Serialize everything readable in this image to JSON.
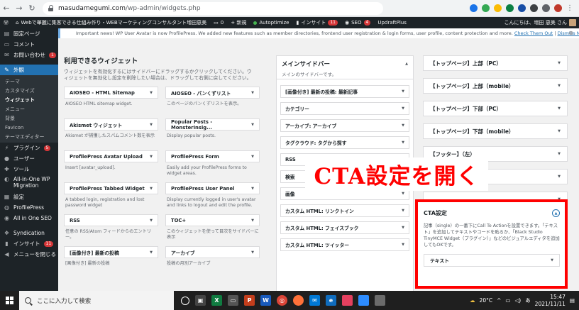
{
  "browser": {
    "url_host": "masudamegumi.com",
    "url_path": "/wp-admin/widgets.php"
  },
  "adminbar": {
    "site": "Webで華麗に集客できる仕組み作り・WEBマーケティングコンサルタント増田恵美",
    "comments": "0",
    "new_label": "+ 新規",
    "autoptimize": "Autoptimize",
    "insight": "インサイト",
    "insight_count": "11",
    "seo": "SEO",
    "seo_count": "4",
    "updraft": "UpdraftPlus",
    "greeting": "こんにちは、増田 恵美 さん"
  },
  "sidebar": {
    "items_top": [
      {
        "label": "固定ページ",
        "icon": "page-icon"
      },
      {
        "label": "コメント",
        "icon": "comment-icon"
      },
      {
        "label": "お問い合わせ",
        "icon": "mail-icon",
        "badge": "1"
      },
      {
        "label": "外観",
        "icon": "brush-icon"
      }
    ],
    "sub": [
      "テーマ",
      "カスタマイズ",
      "ウィジェット",
      "メニュー",
      "背景",
      "Favicon",
      "テーマエディター"
    ],
    "items_bottom": [
      {
        "label": "プラグイン",
        "icon": "plugin-icon",
        "badge": "5"
      },
      {
        "label": "ユーザー",
        "icon": "user-icon"
      },
      {
        "label": "ツール",
        "icon": "tool-icon"
      },
      {
        "label": "All-in-One WP Migration",
        "icon": "migration-icon"
      },
      {
        "label": "設定",
        "icon": "settings-icon"
      },
      {
        "label": "ProfilePress",
        "icon": "profilepress-icon"
      },
      {
        "label": "All in One SEO",
        "icon": "seo-icon"
      },
      {
        "label": "Syndication",
        "icon": "syndication-icon"
      },
      {
        "label": "インサイト",
        "icon": "insight-icon",
        "badge": "11"
      },
      {
        "label": "メニューを閉じる",
        "icon": "collapse-icon"
      }
    ]
  },
  "notice": {
    "text": "Important news! WP User Avatar is now ProfilePress. We added new features such as member directories, frontend user registration & login forms, user profile, content protection and more.",
    "link1": "Check Them Out",
    "sep": "|",
    "link2": "Dismiss Notice"
  },
  "available": {
    "title": "利用できるウィジェット",
    "desc": "ウィジェットを有効化するにはサイドバーにドラッグするかクリックしてください。ウィジェットを無効化し設定を削除したい場合は、ドラッグして右側に戻してください。",
    "widgets": [
      {
        "name": "AIOSEO - HTML Sitemap",
        "desc": "AIOSEO HTML sitemap widget."
      },
      {
        "name": "AIOSEO - パンくずリスト",
        "desc": "このページのパンくずリストを表示。"
      },
      {
        "name": "Akismet ウィジェット",
        "desc": "Akismet が捕獲したスパムコメント数を表示"
      },
      {
        "name": "Popular Posts - MonsterInsig...",
        "desc": "Display popular posts."
      },
      {
        "name": "ProfilePress Avatar Upload",
        "desc": "Insert [avatar_upload]."
      },
      {
        "name": "ProfilePress Form",
        "desc": "Easily add your ProfilePress forms to widget areas."
      },
      {
        "name": "ProfilePress Tabbed Widget",
        "desc": "A tabbed login, registration and lost password widget"
      },
      {
        "name": "ProfilePress User Panel",
        "desc": "Display currently logged in user's avatar and links to logout and edit the profile."
      },
      {
        "name": "RSS",
        "desc": "任意の RSS/Atom フィードからのエントリー。"
      },
      {
        "name": "TOC+",
        "desc": "このウィジェットを使って目次をサイドバーに表示"
      },
      {
        "name": "[画像付き] 最新の投稿",
        "desc": "[画像付き] 最新の投稿"
      },
      {
        "name": "アーカイブ",
        "desc": "投稿の月別アーカイブ"
      }
    ]
  },
  "mainsidebar": {
    "title": "メインサイドバー",
    "desc": "メインのサイドバーです。",
    "widgets": [
      "[画像付き] 最新の投稿: 最新記事",
      "カテゴリー",
      "アーカイブ: アーカイブ",
      "タグクラウド: タグから探す",
      "RSS",
      "検索",
      "画像",
      "カスタム HTML: リンクトイン",
      "カスタム HTML: フェイスブック",
      "カスタム HTML: ツイッター"
    ]
  },
  "rightcol": {
    "areas": [
      "【トップページ】上部（PC）",
      "【トップページ】上部（mobile）",
      "【トップページ】下部（PC）",
      "【トップページ】下部（mobile）",
      "【フッター】（左）",
      "",
      ""
    ]
  },
  "cta": {
    "title": "CTA設定",
    "desc": "記事（single）の一番下にCall To Actionを設置できます。「テキスト」を追加してテキストやコードを貼るか、「Black Studio TinyMCE Widget（プラグイン）」などのビジュアルエディタを追加してもOKです。",
    "widget": "テキスト"
  },
  "overlay_text": "CTA設定を開く",
  "taskbar": {
    "search_placeholder": "ここに入力して検索",
    "temp": "20°C",
    "ime": "あ",
    "time": "15:47",
    "date": "2021/11/11"
  }
}
